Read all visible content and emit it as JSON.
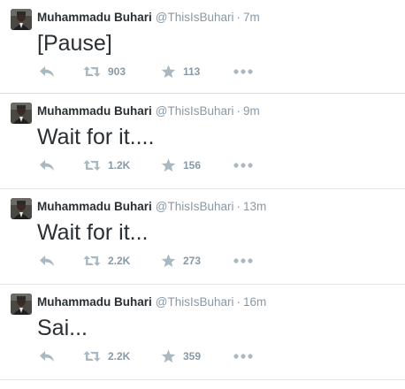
{
  "tweets": [
    {
      "name": "Muhammadu Buhari",
      "handle": "@ThisIsBuhari",
      "separator": "·",
      "time": "7m",
      "text": "[Pause]",
      "retweets": "903",
      "favorites": "113"
    },
    {
      "name": "Muhammadu Buhari",
      "handle": "@ThisIsBuhari",
      "separator": "·",
      "time": "9m",
      "text": "Wait for it....",
      "retweets": "1.2K",
      "favorites": "156"
    },
    {
      "name": "Muhammadu Buhari",
      "handle": "@ThisIsBuhari",
      "separator": "·",
      "time": "13m",
      "text": "Wait for it...",
      "retweets": "2.2K",
      "favorites": "273"
    },
    {
      "name": "Muhammadu Buhari",
      "handle": "@ThisIsBuhari",
      "separator": "·",
      "time": "16m",
      "text": "Sai...",
      "retweets": "2.2K",
      "favorites": "359"
    }
  ],
  "icons": {
    "reply": "reply-icon",
    "retweet": "retweet-icon",
    "favorite": "star-icon",
    "more": "more-dots-icon"
  },
  "colors": {
    "icon": "#aab8c2",
    "meta": "#8899a6",
    "divider": "#e1e8ed",
    "name": "#292f33"
  }
}
